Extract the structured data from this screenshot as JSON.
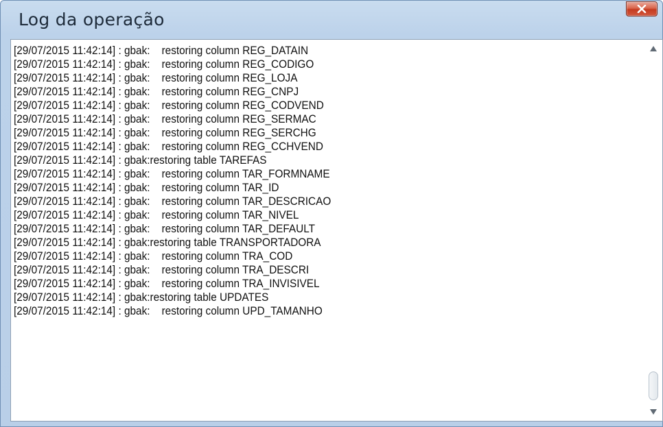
{
  "window": {
    "title": "Log da operação",
    "close_icon": "close-x-icon"
  },
  "log": {
    "lines": [
      "[29/07/2015 11:42:14] : gbak:    restoring column REG_DATAIN",
      "[29/07/2015 11:42:14] : gbak:    restoring column REG_CODIGO",
      "[29/07/2015 11:42:14] : gbak:    restoring column REG_LOJA",
      "[29/07/2015 11:42:14] : gbak:    restoring column REG_CNPJ",
      "[29/07/2015 11:42:14] : gbak:    restoring column REG_CODVEND",
      "[29/07/2015 11:42:14] : gbak:    restoring column REG_SERMAC",
      "[29/07/2015 11:42:14] : gbak:    restoring column REG_SERCHG",
      "[29/07/2015 11:42:14] : gbak:    restoring column REG_CCHVEND",
      "[29/07/2015 11:42:14] : gbak:restoring table TAREFAS",
      "[29/07/2015 11:42:14] : gbak:    restoring column TAR_FORMNAME",
      "[29/07/2015 11:42:14] : gbak:    restoring column TAR_ID",
      "[29/07/2015 11:42:14] : gbak:    restoring column TAR_DESCRICAO",
      "[29/07/2015 11:42:14] : gbak:    restoring column TAR_NIVEL",
      "[29/07/2015 11:42:14] : gbak:    restoring column TAR_DEFAULT",
      "[29/07/2015 11:42:14] : gbak:restoring table TRANSPORTADORA",
      "[29/07/2015 11:42:14] : gbak:    restoring column TRA_COD",
      "[29/07/2015 11:42:14] : gbak:    restoring column TRA_DESCRI",
      "[29/07/2015 11:42:14] : gbak:    restoring column TRA_INVISIVEL",
      "[29/07/2015 11:42:14] : gbak:restoring table UPDATES",
      "[29/07/2015 11:42:14] : gbak:    restoring column UPD_TAMANHO"
    ]
  },
  "scrollbar": {
    "up_icon": "arrow-up-icon",
    "down_icon": "arrow-down-icon",
    "position": 0.97
  },
  "colors": {
    "title_bar": "#bcd2ea",
    "close_button": "#c43b20"
  }
}
